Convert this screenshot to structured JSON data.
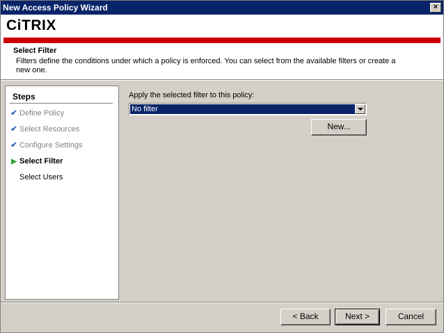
{
  "window": {
    "title": "New Access Policy Wizard",
    "close_glyph": "×"
  },
  "header": {
    "logo_text": "CiTRIX",
    "step_title": "Select Filter",
    "step_description": "Filters define the conditions under which a policy is enforced. You can select from the available filters or create a new one."
  },
  "steps": {
    "heading": "Steps",
    "items": [
      {
        "label": "Define Policy",
        "state": "done",
        "mark": "✔"
      },
      {
        "label": "Select Resources",
        "state": "done",
        "mark": "✔"
      },
      {
        "label": "Configure Settings",
        "state": "done",
        "mark": "✔"
      },
      {
        "label": "Select Filter",
        "state": "current",
        "mark": "▶"
      },
      {
        "label": "Select Users",
        "state": "pending",
        "mark": ""
      }
    ]
  },
  "filter": {
    "label": "Apply the selected filter to this policy:",
    "selected": "No filter",
    "new_button": "New..."
  },
  "footer": {
    "back_button": "< Back",
    "next_button": "Next >",
    "cancel_button": "Cancel"
  },
  "colors": {
    "titlebar": "#0a246a",
    "brand_red": "#cc0000",
    "done_check": "#3060b0",
    "current_arrow": "#30a030"
  }
}
